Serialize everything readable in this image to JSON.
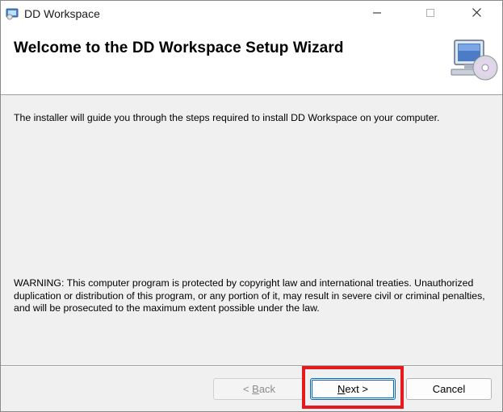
{
  "window": {
    "title": "DD Workspace",
    "icons": {
      "app": "setup-icon",
      "minimize": "minimize-icon",
      "maximize": "maximize-icon",
      "close": "close-icon"
    }
  },
  "header": {
    "title": "Welcome to the DD Workspace Setup Wizard",
    "icon": "computer-disc-icon"
  },
  "content": {
    "intro": "The installer will guide you through the steps required to install DD Workspace on your computer.",
    "warning": "WARNING: This computer program is protected by copyright law and international treaties. Unauthorized duplication or distribution of this program, or any portion of it, may result in severe civil or criminal penalties, and will be prosecuted to the maximum extent possible under the law."
  },
  "buttons": {
    "back": {
      "prefix": "< ",
      "accel": "B",
      "rest": "ack",
      "enabled": false
    },
    "next": {
      "accel": "N",
      "rest": "ext >",
      "default": true
    },
    "cancel": {
      "label": "Cancel"
    }
  },
  "colors": {
    "highlight": "#e8191c",
    "accent": "#0067c0",
    "dialog_bg": "#f0f0f0"
  }
}
